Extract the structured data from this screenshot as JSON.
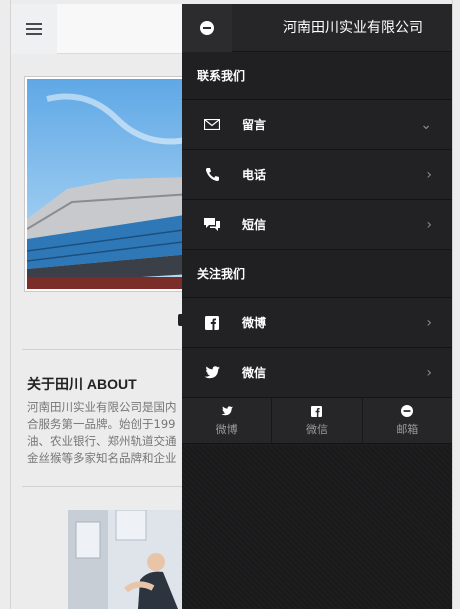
{
  "about": {
    "title": "关于田川 ABOUT",
    "lines": [
      "河南田川实业有限公司是国内",
      "合服务第一品牌。始创于199",
      "油、农业银行、郑州轨道交通",
      "金丝猴等多家知名品牌和企业"
    ]
  },
  "drawer": {
    "title": "河南田川实业有限公司",
    "contact_section": "联系我们",
    "contact_items": [
      {
        "label": "留言",
        "icon": "envelope-icon"
      },
      {
        "label": "电话",
        "icon": "phone-icon"
      },
      {
        "label": "短信",
        "icon": "chat-icon"
      }
    ],
    "follow_section": "关注我们",
    "follow_items": [
      {
        "label": "微博",
        "icon": "facebook-icon"
      },
      {
        "label": "微信",
        "icon": "twitter-icon"
      }
    ],
    "bottom_items": [
      {
        "label": "微博",
        "icon": "twitter-icon"
      },
      {
        "label": "微信",
        "icon": "facebook-icon"
      },
      {
        "label": "邮箱",
        "icon": "minus-circle-icon"
      }
    ]
  },
  "colors": {
    "drawer_bg": "#1d1d1f",
    "page_bg": "#ececed",
    "text_muted": "#767676"
  }
}
